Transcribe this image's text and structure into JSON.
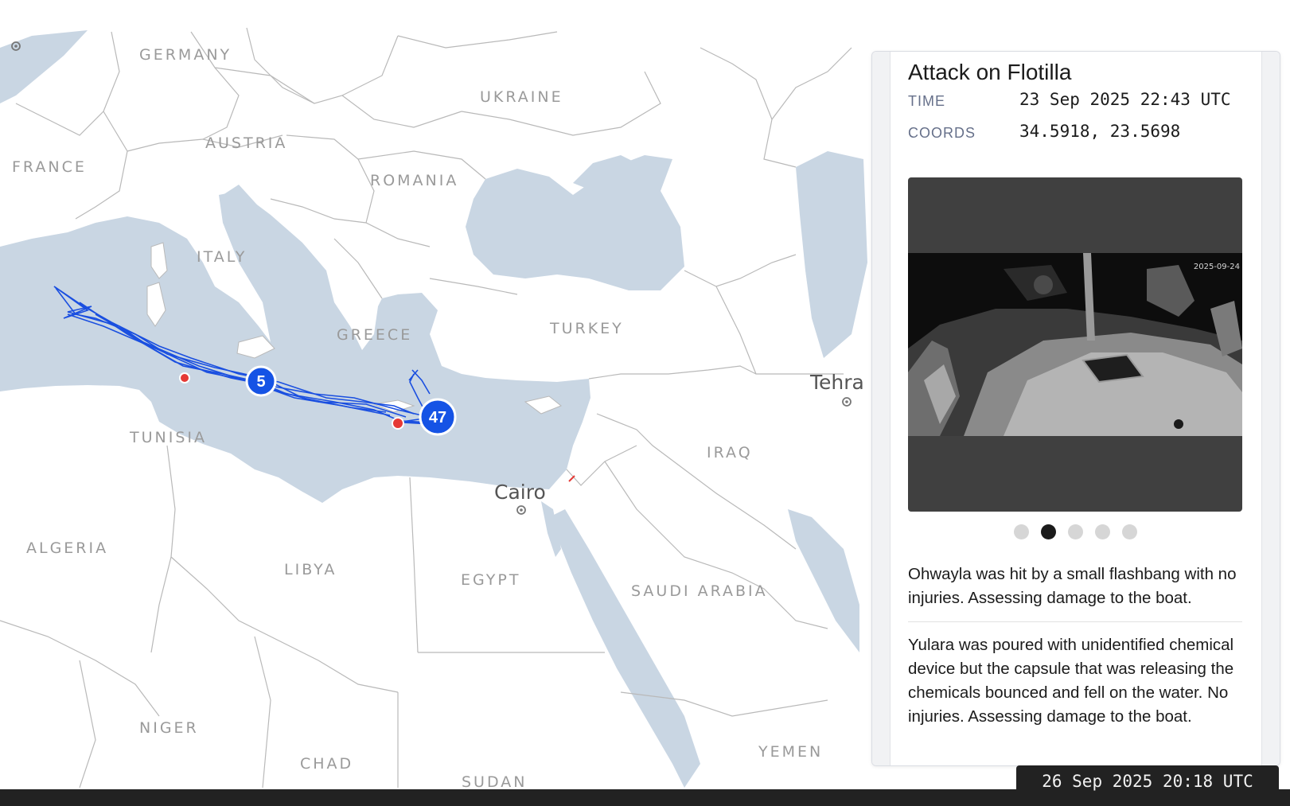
{
  "map": {
    "country_labels": {
      "germany": "GERMANY",
      "ukraine": "UKRAINE",
      "austria": "AUSTRIA",
      "france": "FRANCE",
      "romania": "ROMANIA",
      "italy": "ITALY",
      "greece": "GREECE",
      "turkey": "TURKEY",
      "tunisia": "TUNISIA",
      "iraq": "IRAQ",
      "algeria": "ALGERIA",
      "libya": "LIBYA",
      "egypt": "EGYPT",
      "saudi_arabia": "SAUDI ARABIA",
      "niger": "NIGER",
      "chad": "CHAD",
      "sudan": "SUDAN",
      "yemen": "YEMEN"
    },
    "city_labels": {
      "cairo": "Cairo",
      "tehran": "Tehra"
    },
    "clusters": [
      {
        "count": "5"
      },
      {
        "count": "47"
      }
    ],
    "colors": {
      "water": "#c9d6e3",
      "land": "#ffffff",
      "border": "#b9b9b9",
      "track": "#1a4fe0",
      "cluster": "#1553e5",
      "incident": "#e53935"
    }
  },
  "panel": {
    "title": "Attack on Flotilla",
    "meta": {
      "time_label": "TIME",
      "time_value": "23 Sep 2025 22:43 UTC",
      "coords_label": "COORDS",
      "coords_value": "34.5918, 23.5698"
    },
    "media": {
      "timestamp_overlay": "2025-09-24",
      "slide_count": 5,
      "active_slide": 2
    },
    "descriptions": [
      "Ohwayla was hit by a small flashbang with no injuries. Assessing damage to the boat.",
      "Yulara was poured with unidentified chemical device but the capsule that was releasing the chemicals bounced and fell on the water. No injuries. Assessing damage to the boat."
    ]
  },
  "timeline": {
    "current_time": "26 Sep 2025 20:18 UTC"
  }
}
